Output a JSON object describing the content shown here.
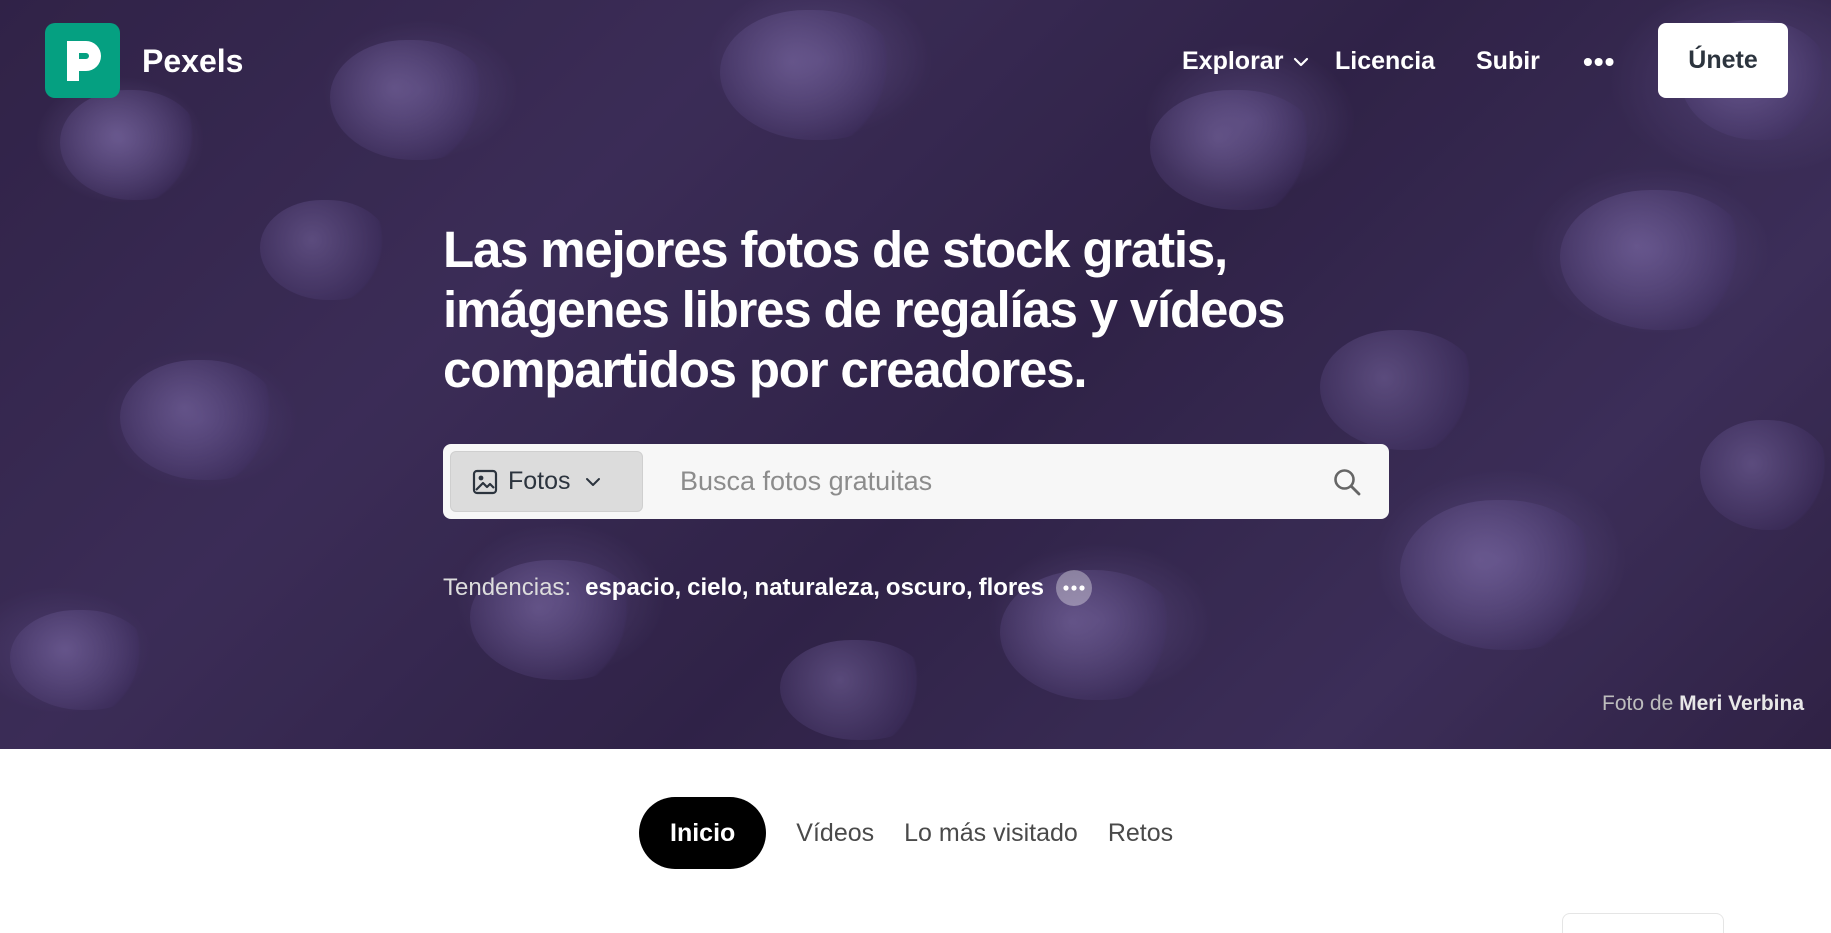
{
  "brand": {
    "name": "Pexels",
    "logo_letter": "P",
    "accent": "#05a081"
  },
  "nav": {
    "explore_label": "Explorar",
    "license_label": "Licencia",
    "upload_label": "Subir",
    "more_label": "•••",
    "join_label": "Únete"
  },
  "hero": {
    "headline": "Las mejores fotos de stock gratis, imágenes libres de regalías y vídeos compartidos por creadores.",
    "credit_prefix": "Foto de",
    "credit_name": "Meri Verbina"
  },
  "search": {
    "type_label": "Fotos",
    "placeholder": "Busca fotos gratuitas",
    "value": ""
  },
  "trending": {
    "label": "Tendencias:",
    "items": [
      "espacio",
      "cielo",
      "naturaleza",
      "oscuro",
      "flores"
    ]
  },
  "tabs": [
    {
      "label": "Inicio",
      "active": true
    },
    {
      "label": "Vídeos",
      "active": false
    },
    {
      "label": "Lo más visitado",
      "active": false
    },
    {
      "label": "Retos",
      "active": false
    }
  ]
}
